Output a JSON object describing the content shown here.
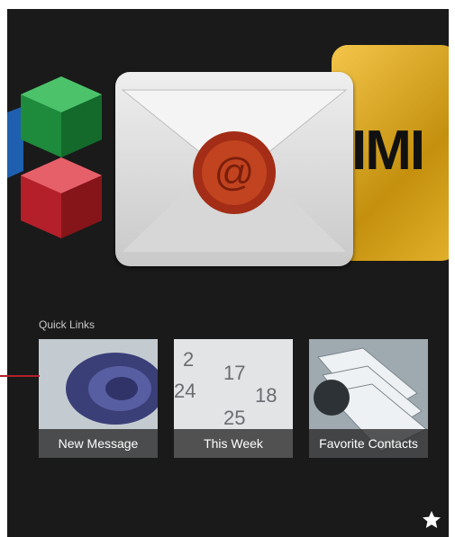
{
  "carousel": {
    "apps": [
      {
        "icon": "cubes-app-icon"
      },
      {
        "icon": "mail-app-icon"
      },
      {
        "icon": "imdb-app-icon",
        "text": "IMI"
      }
    ]
  },
  "quick_links": {
    "label": "Quick Links",
    "tiles": [
      {
        "label": "New Message",
        "icon": "wax-seal-image"
      },
      {
        "label": "This Week",
        "icon": "calendar-image"
      },
      {
        "label": "Favorite Contacts",
        "icon": "rolodex-image"
      }
    ]
  },
  "colors": {
    "background": "#1a1a1a",
    "callout": "#b3202a",
    "imdb_yellow": "#e3b22b"
  }
}
